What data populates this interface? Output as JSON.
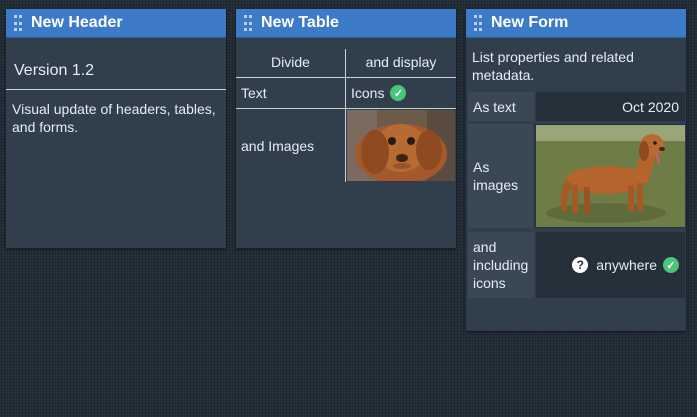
{
  "panels": {
    "header": {
      "title": "New Header",
      "version": "Version 1.2",
      "description": "Visual update of headers, tables, and forms."
    },
    "table": {
      "title": "New Table",
      "columns": [
        "Divide",
        "and display"
      ],
      "rows": [
        {
          "label": "Text",
          "value": "Icons",
          "icon": "check-circle-icon"
        },
        {
          "label": "and Images",
          "image": "dog-face-photo"
        }
      ]
    },
    "form": {
      "title": "New Form",
      "description": "List properties and related metadata.",
      "rows": [
        {
          "label": "As text",
          "value": "Oct 2020"
        },
        {
          "label": "As images",
          "image": "dog-standing-photo"
        },
        {
          "label": "and including icons",
          "value": "anywhere",
          "icons": [
            "question-circle-icon",
            "check-circle-icon"
          ]
        }
      ]
    }
  },
  "colors": {
    "accent": "#3d7bc8",
    "panel": "#313e4b",
    "check": "#4cc47c"
  }
}
